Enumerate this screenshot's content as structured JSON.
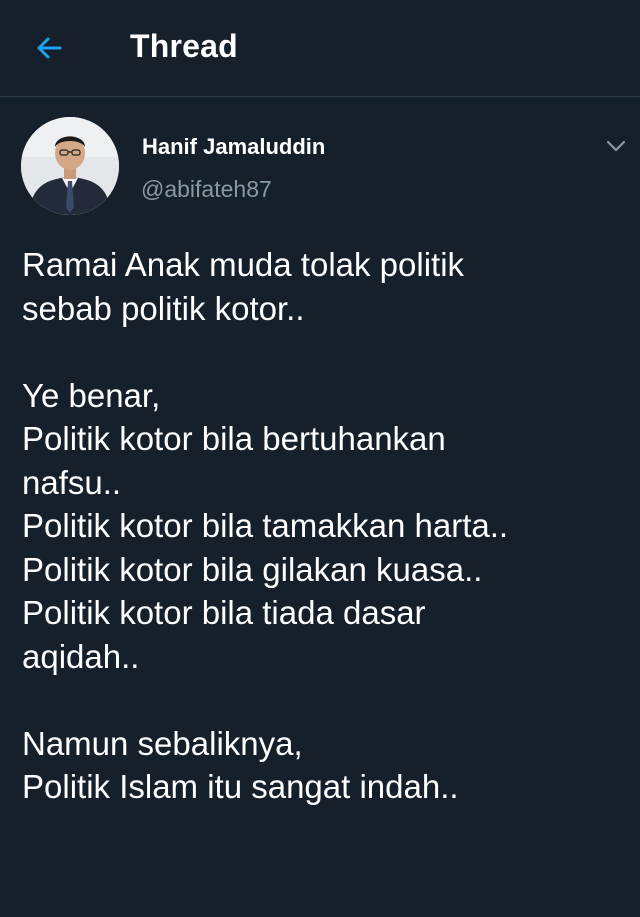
{
  "header": {
    "back_icon": "arrow-left-icon",
    "title": "Thread"
  },
  "tweet": {
    "author": {
      "name": "Hanif Jamaluddin",
      "handle": "@abifateh87",
      "avatar_icon": "user-photo"
    },
    "more_icon": "chevron-down-icon",
    "paragraphs": [
      [
        "Ramai Anak muda tolak politik",
        "sebab politik kotor.."
      ],
      [
        "Ye benar,",
        "Politik kotor bila bertuhankan",
        "nafsu..",
        "Politik kotor bila tamakkan harta..",
        "Politik kotor bila gilakan kuasa..",
        "Politik kotor bila tiada dasar",
        "aqidah.."
      ],
      [
        "Namun sebaliknya,",
        "Politik Islam itu sangat indah.."
      ]
    ]
  },
  "colors": {
    "background": "#15202b",
    "accent": "#1da1f2",
    "text": "#ffffff",
    "secondary_text": "#8899a6",
    "divider": "#2c3b4a"
  }
}
